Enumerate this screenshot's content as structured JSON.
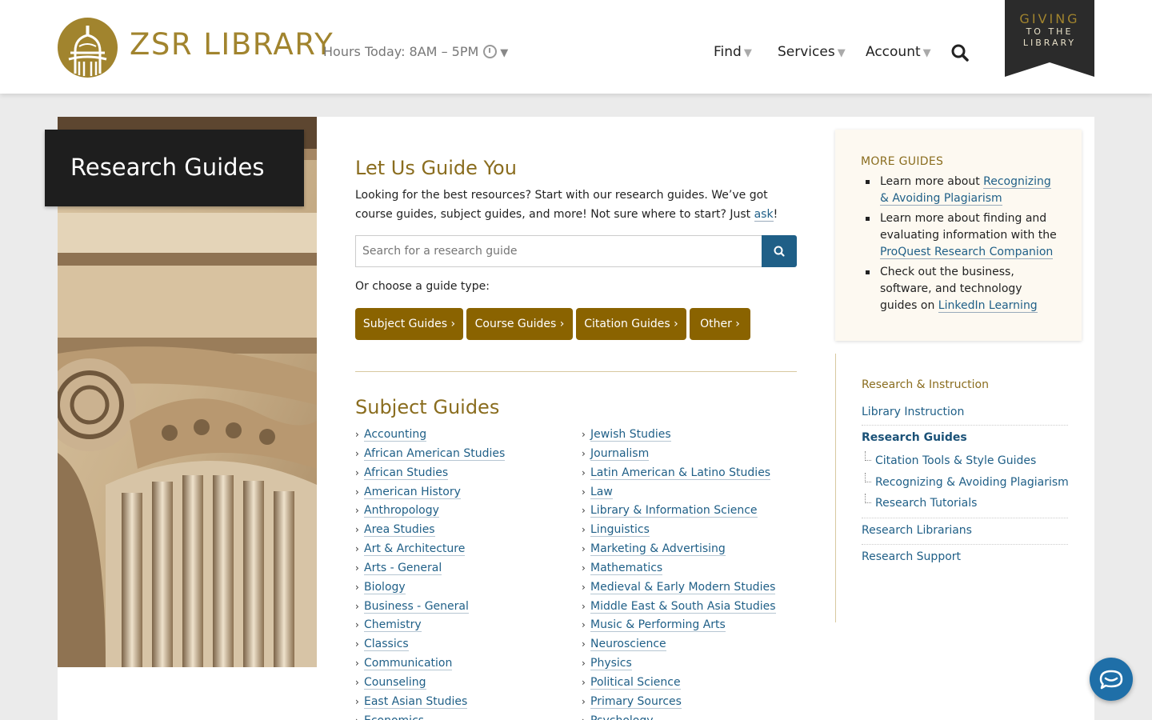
{
  "header": {
    "logo_text": "ZSR LIBRARY",
    "hours": "Hours Today: 8AM – 5PM",
    "nav": [
      {
        "label": "Find"
      },
      {
        "label": "Services"
      },
      {
        "label": "Account"
      }
    ],
    "giving": {
      "line1": "GIVING",
      "line2": "TO THE",
      "line3": "LIBRARY"
    }
  },
  "page": {
    "title": "Research Guides"
  },
  "main": {
    "heading": "Let Us Guide You",
    "intro_text": "Looking for the best resources? Start with our research guides. We’ve got course guides, subject guides, and more! Not sure where to start? Just ",
    "intro_link": "ask",
    "intro_end": "!",
    "search_placeholder": "Search for a research guide",
    "choose_label": "Or choose a guide type:",
    "guide_types": [
      "Subject Guides ›",
      "Course Guides ›",
      "Citation Guides ›",
      "Other ›"
    ],
    "subject_heading": "Subject Guides",
    "subjects_left": [
      "Accounting",
      "African American Studies",
      "African Studies",
      "American History",
      "Anthropology",
      "Area Studies",
      "Art & Architecture",
      "Arts - General",
      "Biology",
      "Business - General",
      "Chemistry",
      "Classics",
      "Communication",
      "Counseling",
      "East Asian Studies",
      "Economics"
    ],
    "subjects_right": [
      "Jewish Studies",
      "Journalism",
      "Latin American & Latino Studies",
      "Law",
      "Library & Information Science",
      "Linguistics",
      "Marketing & Advertising",
      "Mathematics",
      "Medieval & Early Modern Studies",
      "Middle East & South Asia Studies",
      "Music & Performing Arts",
      "Neuroscience",
      "Physics",
      "Political Science",
      "Primary Sources",
      "Psychology"
    ]
  },
  "more_guides": {
    "heading": "MORE GUIDES",
    "item1_text": "Learn more about ",
    "item1_link": "Recognizing & Avoiding Plagiarism",
    "item2_text": "Learn more about finding and evaluating information with the ",
    "item2_link": "ProQuest Research Companion",
    "item3_text": "Check out the business, software, and technology guides on ",
    "item3_link": "LinkedIn Learning"
  },
  "side_nav": {
    "heading": "Research & Instruction",
    "items": [
      "Library Instruction",
      "Research Guides",
      "Research Librarians",
      "Research Support"
    ],
    "sub_items": [
      "Citation Tools & Style Guides",
      "Recognizing & Avoiding Plagiarism",
      "Research Tutorials"
    ]
  },
  "colors": {
    "gold": "#a1842e",
    "button": "#8a6300",
    "link": "#1f5f87",
    "dark": "#1e1e1e"
  }
}
